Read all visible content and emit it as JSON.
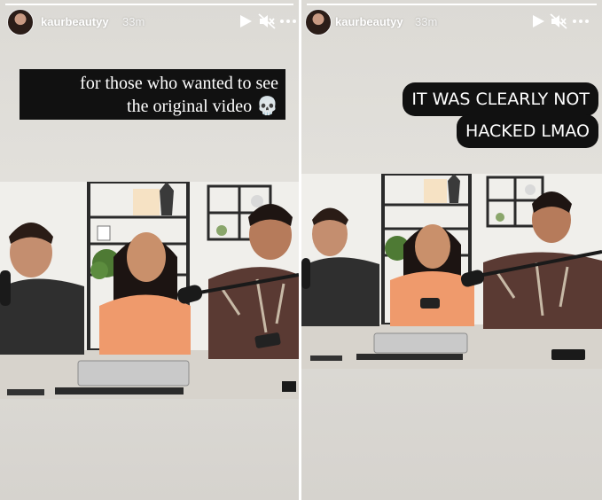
{
  "stories": [
    {
      "username": "kaurbeautyy",
      "timestamp": "33m",
      "caption_lines": [
        "for those who wanted to see",
        "the original video 💀"
      ],
      "progress_percent": 100
    },
    {
      "username": "kaurbeautyy",
      "timestamp": "33m",
      "caption_lines": [
        "IT WAS CLEARLY NOT",
        "HACKED LMAO"
      ],
      "progress_percent": 100
    }
  ],
  "icons": {
    "play": "play-icon",
    "mute": "mute-icon",
    "more": "more-icon"
  },
  "colors": {
    "caption_bg": "#111111",
    "caption_text": "#ffffff",
    "header_text": "#ffffff"
  }
}
